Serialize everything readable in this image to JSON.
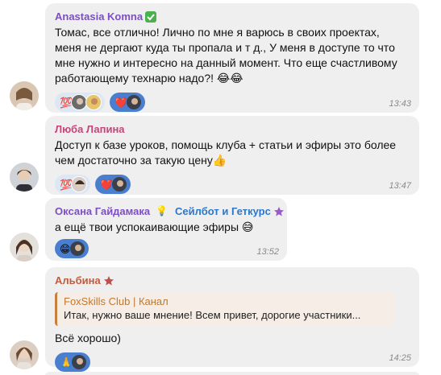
{
  "messages": [
    {
      "sender": "Anastasia Komna",
      "sender_color": "#7c4fc4",
      "badge_icon": "check-mark-icon",
      "lines": [
        "Томас, все отлично! Лично по мне я варюсь в своих проектах,",
        "меня не дергают куда ты пропала и т д., У меня в доступе то что",
        "мне нужно и интересно на данный момент. Что еще счастливому",
        "работающему технарю надо?! 😂😂"
      ],
      "reactions": [
        {
          "emoji": "💯"
        },
        {
          "emoji": "❤️"
        }
      ],
      "time": "13:43"
    },
    {
      "sender": "Люба Лапина",
      "sender_color": "#c7447a",
      "lines": [
        "Доступ к базе уроков, помощь клуба + статьи и эфиры это более",
        "чем достаточно за такую цену👍"
      ],
      "reactions": [
        {
          "emoji": "💯"
        },
        {
          "emoji": "❤️"
        }
      ],
      "time": "13:47"
    },
    {
      "sender": "Оксана Гайдамака",
      "sender_color": "#7c4fc4",
      "sender_emoji": "💡",
      "sender_tag": "Сейлбот и Геткурс",
      "tag_icon": "star-icon",
      "lines": [
        "а ещё твои успокаивающие эфиры 😅"
      ],
      "reactions": [
        {
          "emoji": "😁"
        }
      ],
      "time": "13:52"
    },
    {
      "sender": "Альбина",
      "sender_color": "#c55a3a",
      "tag_icon": "star-icon",
      "quote": {
        "title": "FoxSkills Club | Канал",
        "text": "Итак, нужно ваше мнение!   Всем привет, дорогие участники..."
      },
      "lines": [
        "Всё хорошо)"
      ],
      "reactions": [
        {
          "emoji": "🙏"
        }
      ],
      "time": "14:25"
    }
  ],
  "colors": {
    "bubble": "#efefef",
    "reaction_other": "#dde7f3",
    "reaction_mine": "#4a7fcf",
    "time": "#8a8a8a"
  }
}
